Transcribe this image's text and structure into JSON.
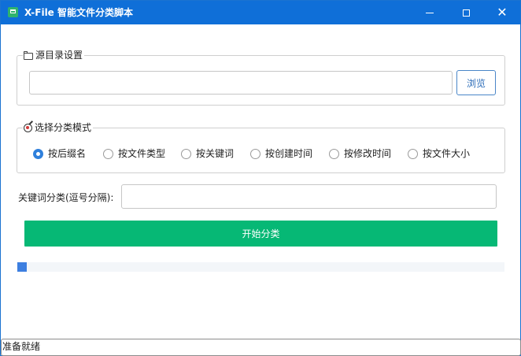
{
  "window": {
    "title": "X-File 智能文件分类脚本",
    "minimize_icon": "minimize-icon",
    "maximize_icon": "maximize-icon",
    "close_glyph": "✕"
  },
  "source_group": {
    "legend": "源目录设置",
    "path_value": "",
    "browse_label": "浏览"
  },
  "mode_group": {
    "legend": "选择分类模式",
    "selected": "按后缀名",
    "options": [
      "按后缀名",
      "按文件类型",
      "按关键词",
      "按创建时间",
      "按修改时间",
      "按文件大小"
    ]
  },
  "keyword": {
    "label": "关键词分类(逗号分隔):",
    "value": ""
  },
  "start_button": {
    "label": "开始分类"
  },
  "progress": {
    "value": 0.02
  },
  "status": {
    "text": "准备就绪"
  },
  "colors": {
    "titlebar": "#0f6fd8",
    "start_button": "#06b875",
    "radio_selected": "#2f80dc",
    "progress_fill": "#3d7fe0"
  }
}
